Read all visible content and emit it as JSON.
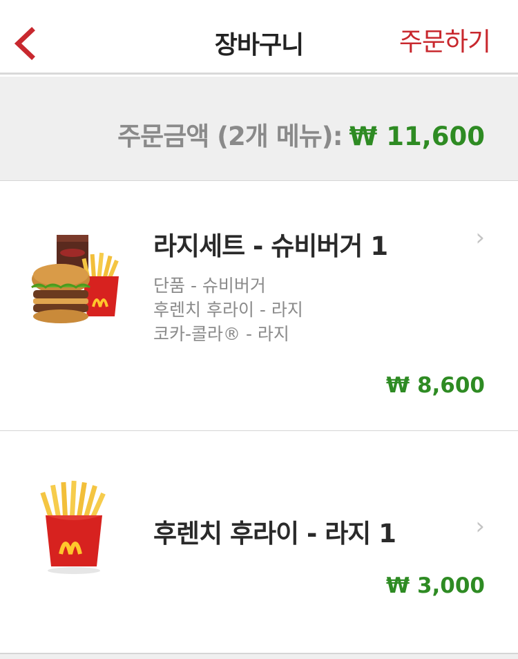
{
  "header": {
    "back_icon": "chevron-left-icon",
    "title": "장바구니",
    "order_label": "주문하기",
    "accent_color": "#c8282e"
  },
  "summary": {
    "label": "주문금액 (2개 메뉴):",
    "total": "₩ 11,600",
    "price_color": "#2e8b23"
  },
  "items": [
    {
      "title": "라지세트 - 슈비버거 1",
      "details": [
        "단품 - 슈비버거",
        "후렌치 후라이 - 라지",
        "코카-콜라® - 라지"
      ],
      "price": "₩ 8,600",
      "image": "burger-set-image",
      "chevron": "›"
    },
    {
      "title": "후렌치 후라이 - 라지 1",
      "details": [],
      "price": "₩ 3,000",
      "image": "fries-image",
      "chevron": "›"
    }
  ]
}
